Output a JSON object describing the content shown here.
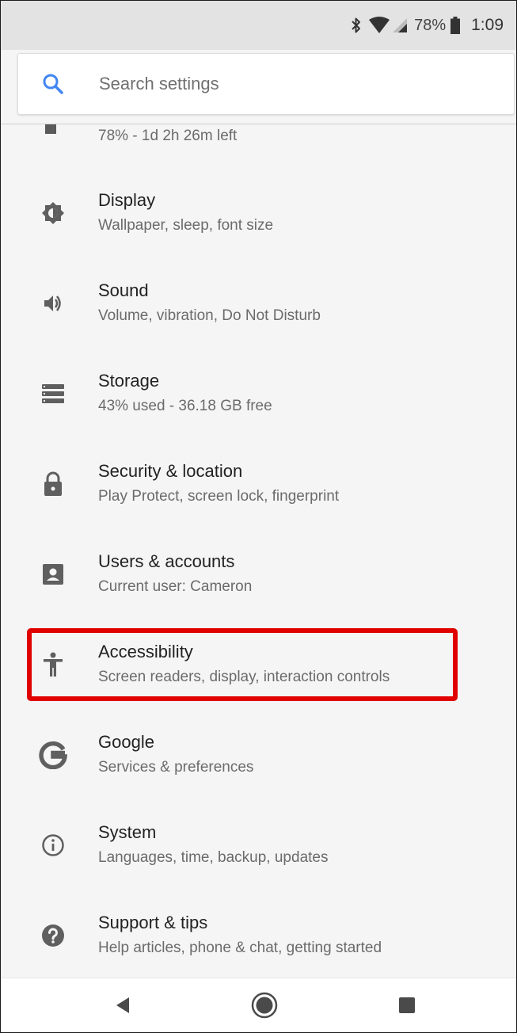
{
  "status_bar": {
    "battery_percent": "78%",
    "time": "1:09",
    "icons": [
      "bluetooth-icon",
      "wifi-icon",
      "cell-signal-icon",
      "battery-icon"
    ]
  },
  "search": {
    "placeholder": "Search settings",
    "icon": "search-icon",
    "accent_color": "#4285f4"
  },
  "partial_item": {
    "icon": "battery-icon",
    "summary": "78% - 1d 2h 26m left"
  },
  "settings": [
    {
      "icon": "brightness-icon",
      "title": "Display",
      "summary": "Wallpaper, sleep, font size"
    },
    {
      "icon": "volume-icon",
      "title": "Sound",
      "summary": "Volume, vibration, Do Not Disturb"
    },
    {
      "icon": "storage-icon",
      "title": "Storage",
      "summary": "43% used - 36.18 GB free"
    },
    {
      "icon": "lock-icon",
      "title": "Security & location",
      "summary": "Play Protect, screen lock, fingerprint"
    },
    {
      "icon": "account-box-icon",
      "title": "Users & accounts",
      "summary": "Current user: Cameron"
    },
    {
      "icon": "accessibility-icon",
      "title": "Accessibility",
      "summary": "Screen readers, display, interaction controls"
    },
    {
      "icon": "google-icon",
      "title": "Google",
      "summary": "Services & preferences"
    },
    {
      "icon": "info-icon",
      "title": "System",
      "summary": "Languages, time, backup, updates"
    },
    {
      "icon": "help-icon",
      "title": "Support & tips",
      "summary": "Help articles, phone & chat, getting started"
    }
  ],
  "highlight": {
    "item": "Accessibility",
    "color": "#e00000"
  },
  "nav_bar": {
    "buttons": [
      "back-icon",
      "home-icon",
      "recents-icon"
    ]
  }
}
